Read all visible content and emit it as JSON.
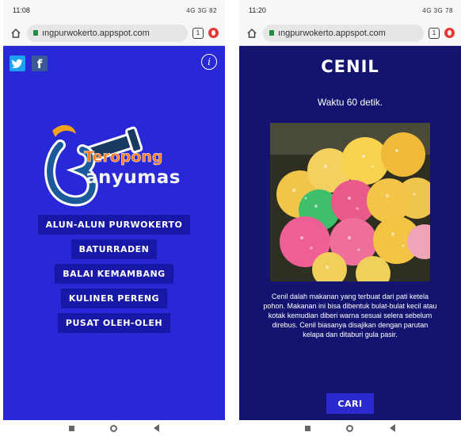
{
  "left_screen": {
    "status": {
      "time": "11:08",
      "icons": "4G 3G",
      "battery": "82"
    },
    "url": "ıngpurwokerto.appspot.com",
    "tab_count": "1",
    "logo": {
      "line1": "Teropong",
      "line2": "Banyumas"
    },
    "menu": [
      {
        "label": "ALUN-ALUN PURWOKERTO"
      },
      {
        "label": "BATURRADEN"
      },
      {
        "label": "BALAI KEMAMBANG"
      },
      {
        "label": "KULINER PERENG"
      },
      {
        "label": "PUSAT OLEH-OLEH"
      }
    ]
  },
  "right_screen": {
    "status": {
      "time": "11:20",
      "icons": "4G 3G",
      "battery": "78"
    },
    "url": "ıngpurwokerto.appspot.com",
    "tab_count": "1",
    "title": "CENIL",
    "timer": "Waktu 60 detik.",
    "description": "Cenil dalah makanan yang terbuat dari pati ketela pohon. Makanan ini bisa dibentuk bulat-bulat kecil atau kotak kemudian diberi warna sesuai selera sebelum direbus. Cenil biasanya disajikan dengan parutan kelapa dan ditaburi gula pasir.",
    "button_label": "CARI"
  },
  "colors": {
    "left_background": "#2828d6",
    "right_background": "#141470",
    "menu_button": "#1818a8",
    "logo_orange": "#ff7a1a"
  }
}
